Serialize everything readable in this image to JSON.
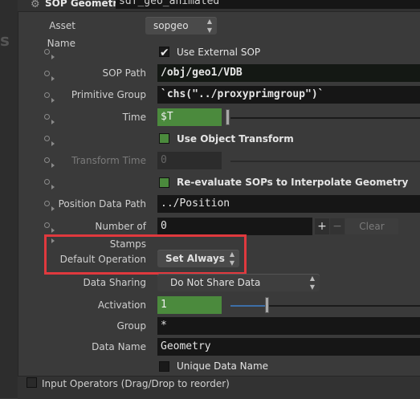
{
  "header": {
    "title": "SOP Geometry",
    "node_name": "sdf_geo_animated",
    "gear_icon": "gear-icon"
  },
  "asset": {
    "label": "Asset Name",
    "value": "sopgeo"
  },
  "params": {
    "use_external_sop": {
      "label": "Use External SOP",
      "checked": true
    },
    "sop_path": {
      "label": "SOP Path",
      "value": "/obj/geo1/VDB"
    },
    "primitive_group": {
      "label": "Primitive Group",
      "value": "`chs(\"../proxyprimgroup\")`"
    },
    "time": {
      "label": "Time",
      "value": "$T"
    },
    "use_object_transform": {
      "label": "Use Object Transform",
      "checked": true
    },
    "transform_time": {
      "label": "Transform Time",
      "value": "0"
    },
    "reevaluate": {
      "label": "Re-evaluate SOPs to Interpolate Geometry",
      "checked": true
    },
    "position_data_path": {
      "label": "Position Data Path",
      "value": "../Position"
    },
    "number_of_stamps": {
      "label": "Number of Stamps",
      "value": "0",
      "plus": "+",
      "minus": "−",
      "clear": "Clear"
    },
    "default_operation": {
      "label": "Default Operation",
      "value": "Set Always"
    },
    "data_sharing": {
      "label": "Data Sharing",
      "value": "Do Not Share Data"
    },
    "activation": {
      "label": "Activation",
      "value": "1"
    },
    "group": {
      "label": "Group",
      "value": "*"
    },
    "data_name": {
      "label": "Data Name",
      "value": "Geometry"
    },
    "unique_data_name": {
      "label": "Unique Data Name",
      "checked": false
    }
  },
  "footer": {
    "label": "Input Operators (Drag/Drop to reorder)"
  },
  "colors": {
    "accent_green": "#4b8a3d",
    "highlight_red": "#e0393e",
    "slider_blue": "#3d6fa8"
  }
}
